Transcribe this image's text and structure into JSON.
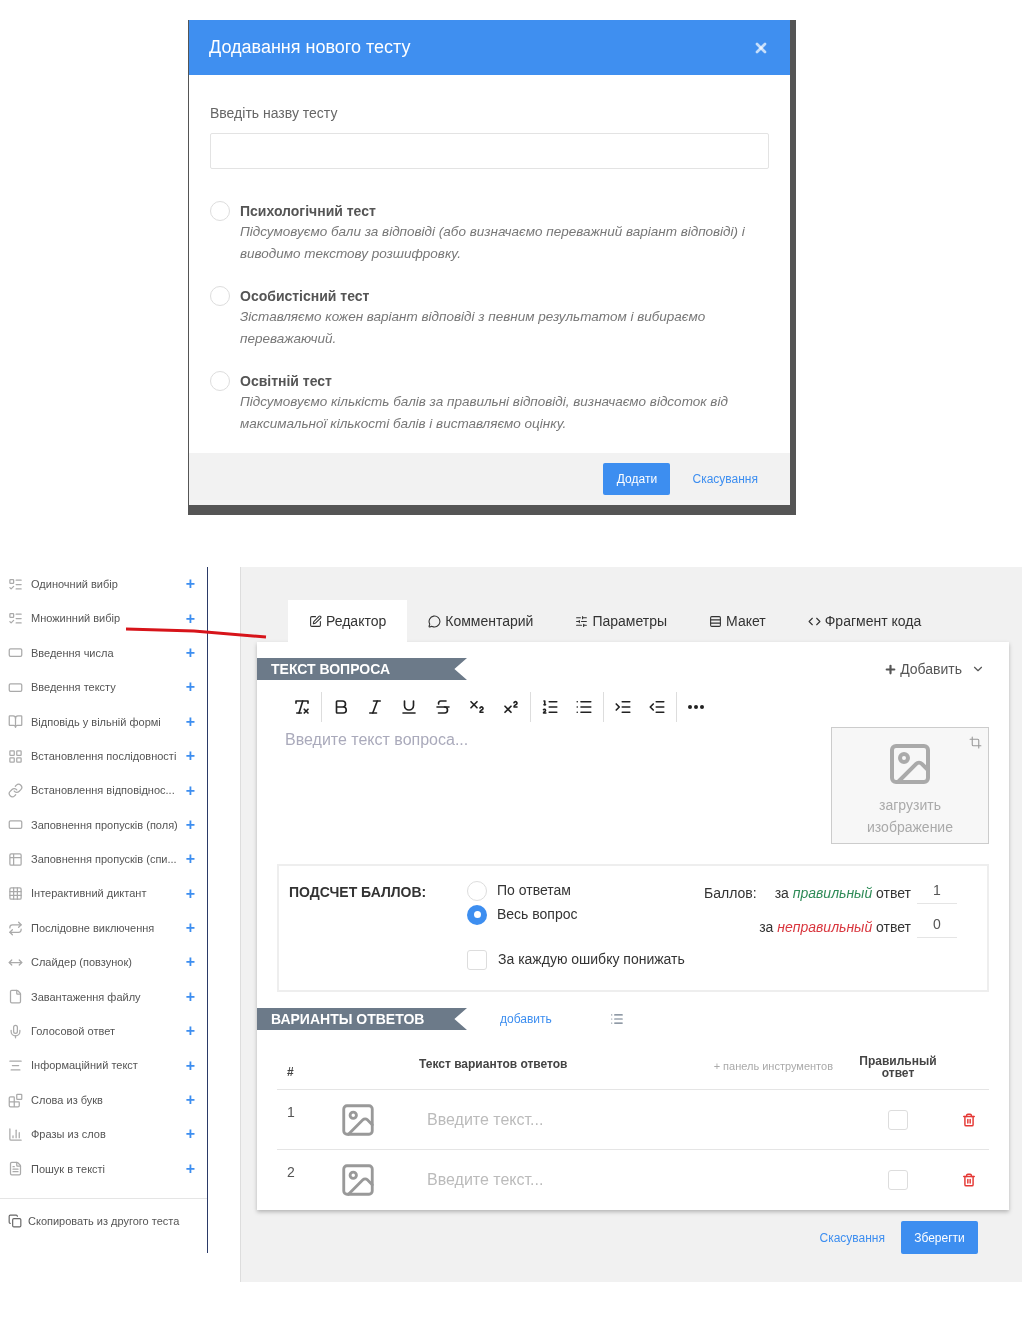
{
  "dialog": {
    "title": "Додавання нового тесту",
    "name_label": "Введіть назву тесту",
    "test_types": [
      {
        "title": "Психологічний тест",
        "description": "Підсумовуємо бали за відповіді (або визначаємо переважний варіант відповіді) і виводимо текстову розшифровку.",
        "selected": false
      },
      {
        "title": "Особистісний тест",
        "description": "Зіставляємо кожен варіант відповіді з певним результатом і вибираємо переважаючий.",
        "selected": false
      },
      {
        "title": "Освітній тест",
        "description": "Підсумовуємо кількість балів за правильні відповіді, визначаємо відсоток від максимальної кількості балів і виставляємо оцінку.",
        "selected": false
      }
    ],
    "add_button": "Додати",
    "cancel_link": "Скасування"
  },
  "sidebar": {
    "items": [
      {
        "label": "Одиночний вибір",
        "add": "+"
      },
      {
        "label": "Множинний вибір",
        "add": "+"
      },
      {
        "label": "Введення числа",
        "add": "+"
      },
      {
        "label": "Введення тексту",
        "add": "+"
      },
      {
        "label": "Відповідь у вільній формі",
        "add": "+"
      },
      {
        "label": "Встановлення послідовності",
        "add": "+"
      },
      {
        "label": "Встановлення відповіднос...",
        "add": "+"
      },
      {
        "label": "Заповнення пропусків (поля)",
        "add": "+"
      },
      {
        "label": "Заповнення пропусків (спи...",
        "add": "+"
      },
      {
        "label": "Інтерактивний диктант",
        "add": "+"
      },
      {
        "label": "Послідовне виключення",
        "add": "+"
      },
      {
        "label": "Слайдер (повзунок)",
        "add": "+"
      },
      {
        "label": "Завантаження файлу",
        "add": "+"
      },
      {
        "label": "Голосовой ответ",
        "add": "+"
      },
      {
        "label": "Інформаційний текст",
        "add": "+"
      },
      {
        "label": "Слова из букв",
        "add": "+"
      },
      {
        "label": "Фразы из слов",
        "add": "+"
      },
      {
        "label": "Пошук в тексті",
        "add": "+"
      }
    ],
    "copy_link": "Скопировать из другого теста"
  },
  "editor": {
    "tabs": [
      {
        "label": "Редактор",
        "selected": true
      },
      {
        "label": "Комментарий",
        "selected": false
      },
      {
        "label": "Параметры",
        "selected": false
      },
      {
        "label": "Макет",
        "selected": false
      },
      {
        "label": "Фрагмент кода",
        "selected": false
      }
    ],
    "question": {
      "heading": "ТЕКСТ ВОПРОСА",
      "add_menu": "Добавить",
      "placeholder": "Введите текст вопроса...",
      "image_upload": "загрузить изображение"
    },
    "scoring": {
      "label": "ПОДСЧЕТ БАЛЛОВ:",
      "modes": [
        {
          "label": "По ответам",
          "selected": false
        },
        {
          "label": "Весь вопрос",
          "selected": true
        }
      ],
      "penalty": {
        "label": "За каждую ошибку понижать",
        "checked": false
      },
      "points_label": "Баллов:",
      "correct": {
        "prefix": "за",
        "word": "правильный",
        "suffix": "ответ",
        "value": "1",
        "color": "#2e8b57"
      },
      "wrong": {
        "prefix": "за",
        "word": "неправильный",
        "suffix": "ответ",
        "value": "0",
        "color": "#d9363e"
      }
    },
    "answers": {
      "heading": "ВАРИАНТЫ ОТВЕТОВ",
      "add_link": "добавить",
      "columns": [
        "#",
        "Текст вариантов ответов",
        "+ панель инструментов",
        "Правильный ответ"
      ],
      "rows": [
        {
          "number": "1",
          "placeholder": "Введите текст...",
          "correct": false
        },
        {
          "number": "2",
          "placeholder": "Введите текст...",
          "correct": false
        }
      ]
    },
    "cancel_link": "Скасування",
    "save_button": "Зберегти"
  }
}
